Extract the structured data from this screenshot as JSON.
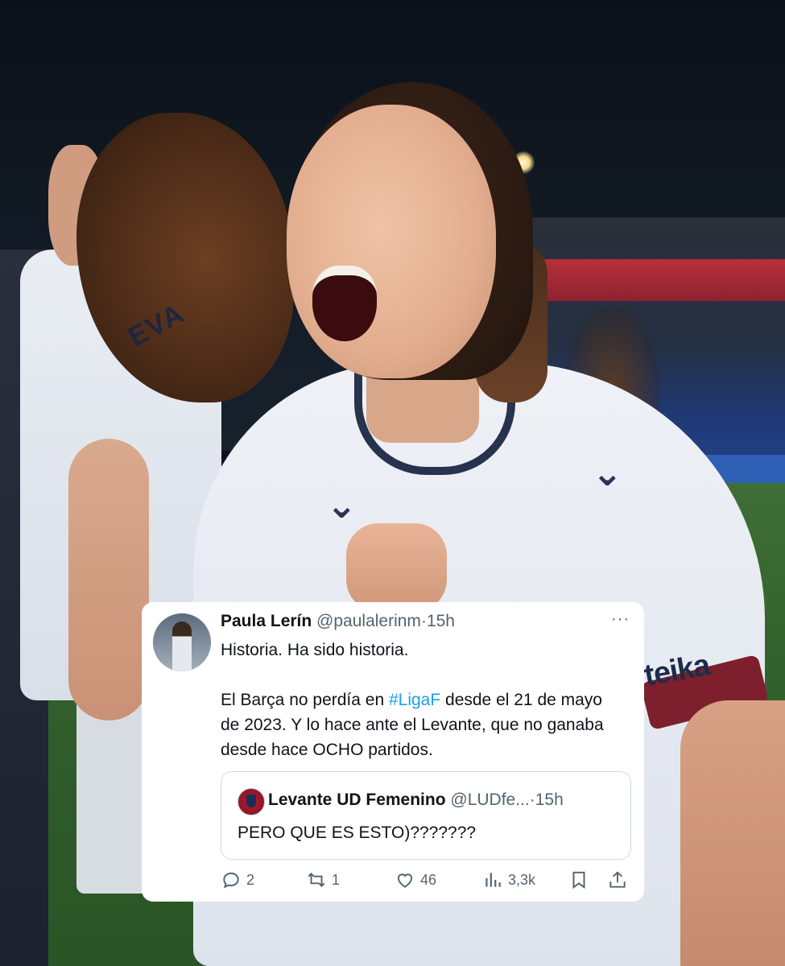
{
  "photo": {
    "shirt_name": "EVA",
    "sponsor": "teika"
  },
  "tweet": {
    "author_name": "Paula Lerín",
    "author_handle": "@paulalerinm",
    "separator": "·",
    "time": "15h",
    "more": "···",
    "line1": "Historia. Ha sido historia.",
    "line2_before": "El Barça no perdía en ",
    "hashtag": "#LigaF",
    "line2_after": " desde el 21 de mayo de 2023. Y lo hace ante el Levante, que no ganaba desde hace OCHO partidos.",
    "quote": {
      "author_name": "Levante UD Femenino",
      "author_handle": "@LUDfe...",
      "separator": "·",
      "time": "15h",
      "text": "PERO QUE ES ESTO)???????"
    },
    "actions": {
      "replies": "2",
      "retweets": "1",
      "likes": "46",
      "views": "3,3k"
    },
    "colors": {
      "link": "#1d9bf0",
      "muted": "#536471",
      "text": "#0f1419"
    }
  }
}
